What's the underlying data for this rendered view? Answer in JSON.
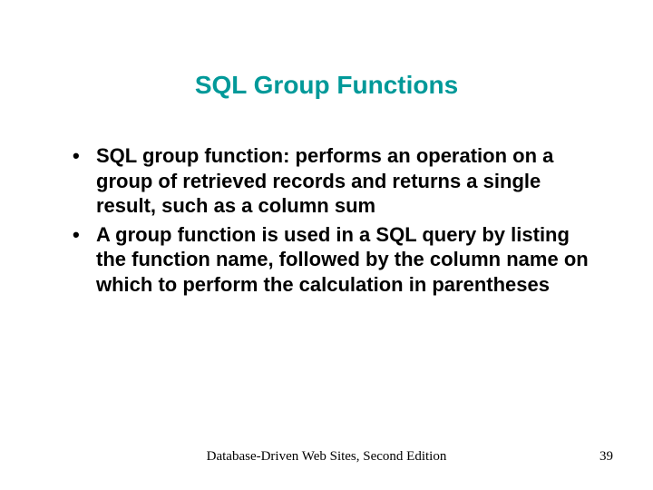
{
  "title": "SQL Group Functions",
  "bullets": [
    "SQL group function: performs an operation on a group of retrieved records and returns a single result, such as a column sum",
    "A group function is used in a SQL query by listing the function name, followed by the column name on which to perform the calculation in parentheses"
  ],
  "footer": {
    "center": "Database-Driven Web Sites, Second Edition",
    "page": "39"
  }
}
